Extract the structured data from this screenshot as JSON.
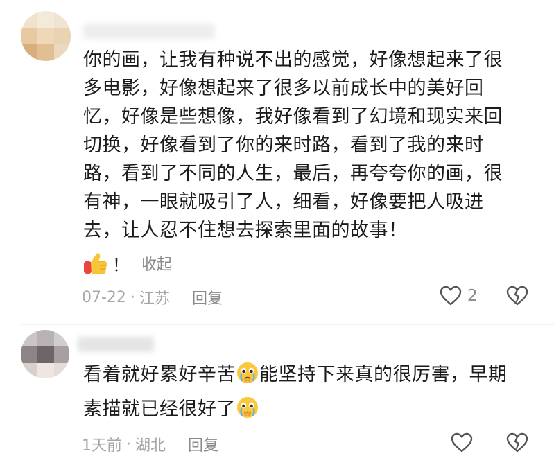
{
  "comments": [
    {
      "username": "",
      "text_lines": [
        "你的画，让我有种说不出的感觉，好像想起来了很",
        "多电影，好像想起来了很多以前成长中的美好回",
        "忆，好像是些想像，我好像看到了幻境和现实来回",
        "切换，好像看到了你的来时路，看到了我的来时",
        "路，看到了不同的人生，最后，再夸夸你的画，很",
        "有神，一眼就吸引了人，细看，好像要把人吸进",
        "去，让人忍不住想去探索里面的故事！"
      ],
      "reaction": {
        "emoji_icon": "thumbs-up-emoji-icon",
        "suffix": "！",
        "collapse_label": "收起"
      },
      "date": "07-22",
      "separator": "·",
      "location": "江苏",
      "reply_label": "回复",
      "like_count": "2",
      "like_icon": "heart-outline-icon",
      "dislike_icon": "broken-heart-icon"
    },
    {
      "username": "",
      "text_segments_line1": {
        "before_emoji": "看着就好累好辛苦",
        "emoji_icon": "crying-face-emoji-icon",
        "after_emoji": "能坚持下来真的很厉害，早期"
      },
      "text_segments_line2": {
        "before_emoji": "素描就已经很好了",
        "emoji_icon": "crying-face-emoji-icon"
      },
      "date": "1天前",
      "separator": "·",
      "location": "湖北",
      "reply_label": "回复",
      "like_count": "",
      "like_icon": "heart-outline-icon",
      "dislike_icon": "broken-heart-icon"
    }
  ],
  "colors": {
    "text_primary": "#1b1b1b",
    "text_meta": "#a6a6a6",
    "text_action": "#8a8a8a",
    "icon_stroke": "#555555"
  }
}
